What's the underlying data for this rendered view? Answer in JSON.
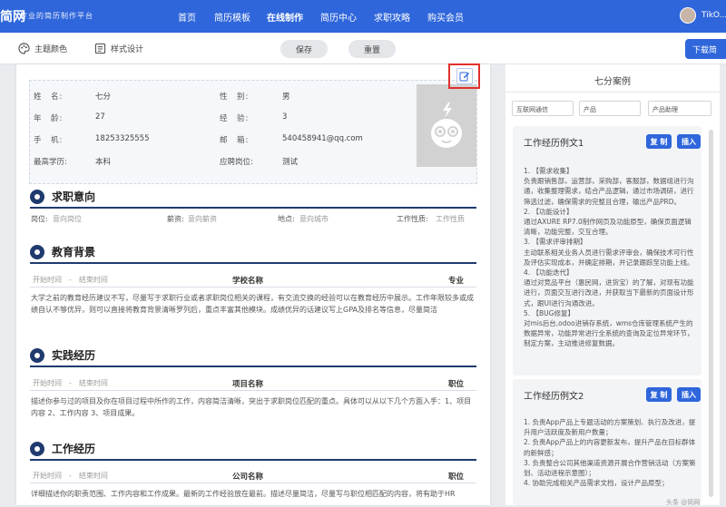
{
  "nav": {
    "logo": "简网",
    "slogan": "专业的简历制作平台",
    "items": [
      "首页",
      "简历模板",
      "在线制作",
      "简历中心",
      "求职攻略",
      "购买会员"
    ],
    "username": "TikO..."
  },
  "toolbar": {
    "theme_color": "主题颜色",
    "style_design": "样式设计",
    "save": "保存",
    "reset": "重置",
    "download": "下载简"
  },
  "basic_info": {
    "name_label": "姓　名:",
    "name": "七分",
    "gender_label": "性　别:",
    "gender": "男",
    "age_label": "年　龄:",
    "age": "27",
    "exp_label": "经　验:",
    "exp": "3",
    "phone_label": "手　机:",
    "phone": "18253325555",
    "email_label": "邮　箱:",
    "email": "540458941@qq.com",
    "edu_label": "最高学历:",
    "edu": "本科",
    "position_label": "应聘岗位:",
    "position": "测试"
  },
  "intent": {
    "title": "求职意向",
    "job_label": "岗位:",
    "job": "意向岗位",
    "salary_label": "薪资:",
    "salary": "意向薪资",
    "city_label": "地点:",
    "city": "意向城市",
    "nature_label": "工作性质:",
    "nature": "工作性质"
  },
  "education": {
    "title": "教育背景",
    "time": "开始时间　-　结束时间",
    "school": "学校名称",
    "major": "专业",
    "desc": "大学之前的教育经历建议不写，尽量写于求职行业或者求职岗位相关的课程，有交流交换的经验可以在教育经历中展示。工作年限较多或成绩自认不够优异，则可以直接将教育背景清晰罗列后，重点丰富其他模块。成绩优异的话建议写上GPA及排名等信息，尽量简洁"
  },
  "practice": {
    "title": "实践经历",
    "time": "开始时间　-　结束时间",
    "project": "项目名称",
    "role": "职位",
    "desc": "描述你参与过的项目及你在项目过程中所作的工作，内容简洁清晰，突出于求职岗位匹配的重点。具体可以从以下几个方面入手：1、项目内容 2、工作内容 3、项目成果。"
  },
  "work": {
    "title": "工作经历",
    "time": "开始时间　-　结束时间",
    "company": "公司名称",
    "role": "职位",
    "desc": "详细描述你的职责范围、工作内容和工作成果。最新的工作经验放在最前。描述尽量简洁，尽量写与职位相匹配的内容，将有助于HR"
  },
  "right_panel": {
    "title": "七分案例",
    "filters": [
      "互联网通信",
      "产品",
      "产品助理"
    ],
    "cards": [
      {
        "title": "工作经历例文1",
        "copy": "复 制",
        "insert": "插入",
        "body": "1. 【需求收集】\n负责跟销售部，运营部，采购部，客服部，数据组进行沟通，收集整理需求，结合产品逻辑，通过市场调研，进行筛选过滤，确保需求的完整且合理，输出产品PRD。\n2. 【功能设计】\n通过AXURE RP7.0制作网页及功能原型，确保页面逻辑清晰，功能完整，交互合理。\n3. 【需求评审排期】\n主动联系相关业务人员进行需求评审会，确保技术可行性及评估实现成本，并确定排期，并记录跟踪至功能上线。\n4. 【功能迭代】\n通过对竞品平台（惠民网，进货宝）的了解，对现有功能进行，页面交互进行改进，并获取当下最新的页面设计形式，跟UI进行沟通改进。\n5. 【BUG修复】\n对mis后台,odoo进销存系统，wms仓库管理系统产生的数据异常，功能异常进行全系统的查询及定位异常环节，制定方案，主动推进修复数据。"
      },
      {
        "title": "工作经历例文2",
        "copy": "复 制",
        "insert": "插入",
        "body": "1. 负责App产品上专题活动的方案策划、执行及改进，提升用户活跃度及新用户数量；\n2. 负责App产品上的内容更新发布，提升产品在目标群体的新鲜感；\n3. 负责整合公司其他渠道资源开展合作营销活动（方案策划、活动进程示意图）；\n4. 协助完成相关产品需求文档，设计产品原型；"
      }
    ]
  },
  "watermark": "头条 @简网"
}
